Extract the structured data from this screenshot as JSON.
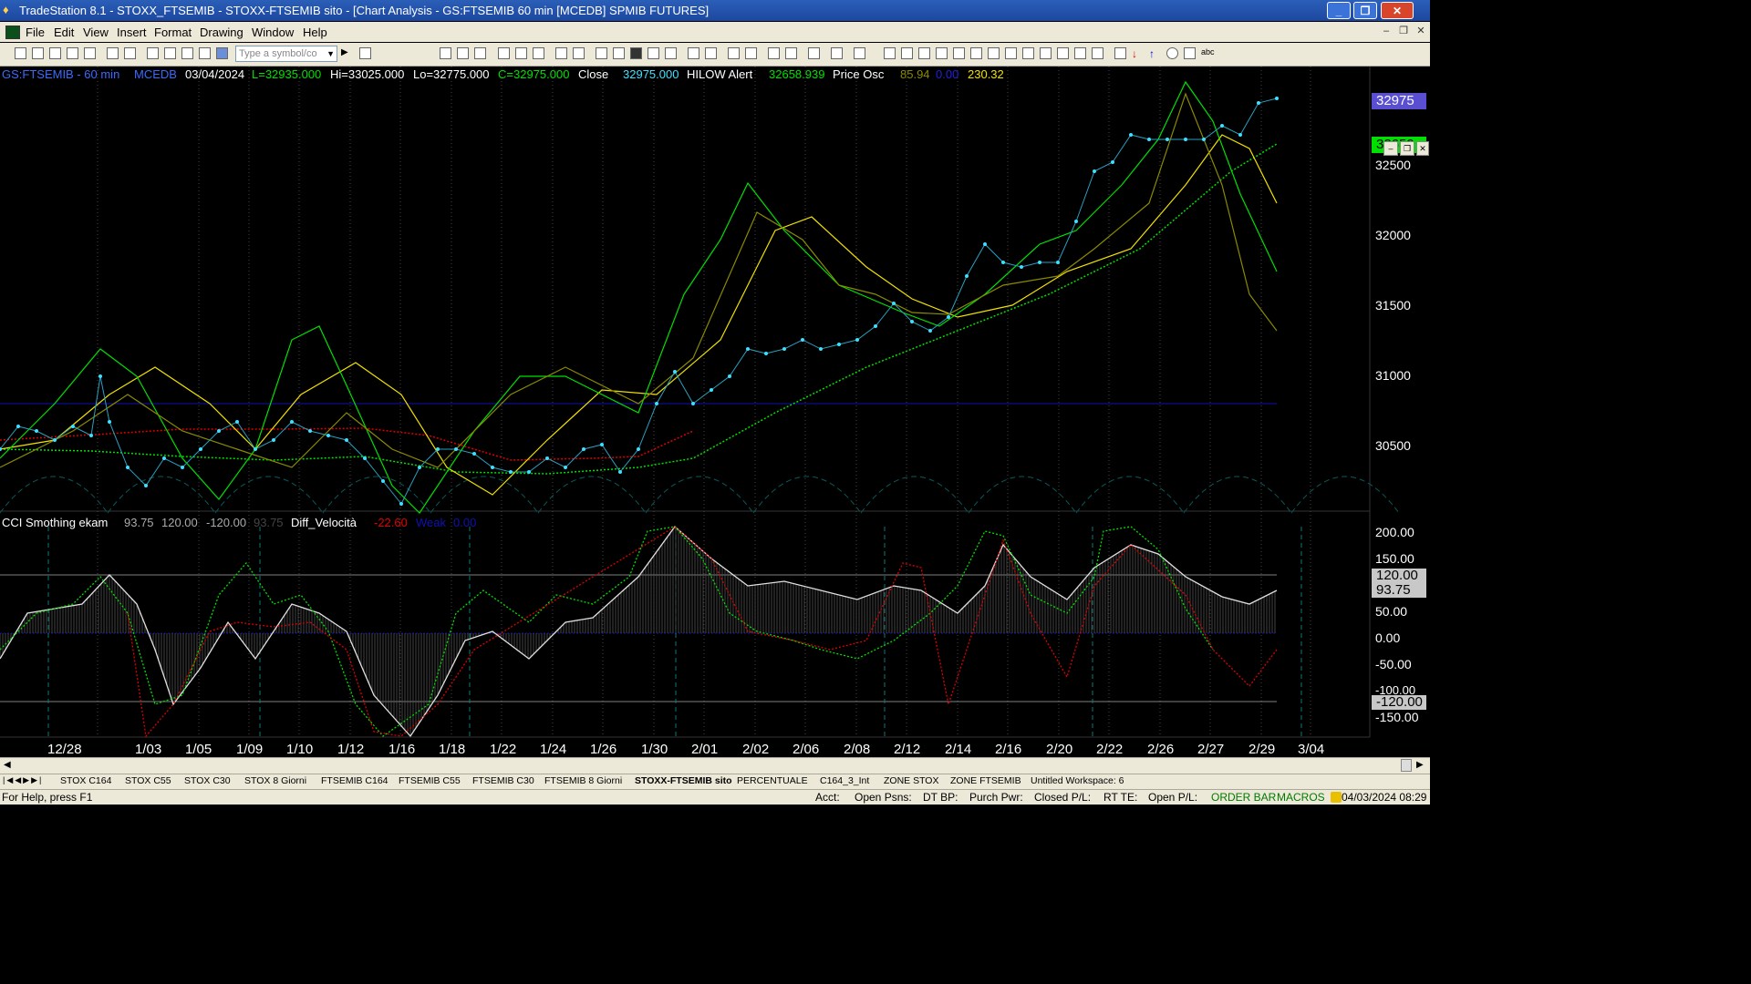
{
  "window": {
    "title": "TradeStation 8.1 - STOXX_FTSEMIB - STOXX-FTSEMIB sito - [Chart Analysis - GS:FTSEMIB  60 min  [MCEDB] SPMIB FUTURES]",
    "min_label": "_",
    "max_label": "❐",
    "close_label": "✕"
  },
  "menu": {
    "items": [
      "File",
      "Edit",
      "View",
      "Insert",
      "Format",
      "Drawing",
      "Window",
      "Help"
    ]
  },
  "toolbar": {
    "symbol_placeholder": "Type a symbol/co"
  },
  "chart_header": {
    "symbol": "GS:FTSEMIB - 60 min",
    "feed": "MCEDB",
    "date": "03/04/2024",
    "last": "L=32935.000",
    "high": "Hi=33025.000",
    "low": "Lo=32775.000",
    "close": "C=32975.000",
    "close_label": "Close",
    "close_value": "32975.000",
    "hilow_label": "HILOW Alert",
    "hilow_value": "32658.939",
    "osc_label": "Price Osc",
    "osc_v1": "85.94",
    "osc_v2": "0.00",
    "osc_v3": "230.32"
  },
  "sub_header": {
    "name": "CCI Smothing ekam",
    "v1": "93.75",
    "v2": "120.00",
    "v3": "-120.00",
    "v4": "93.75",
    "diff_label": "Diff_Velocità",
    "diff_value": "-22.60",
    "weak_label": "Weak",
    "weak_value": "0.00"
  },
  "price_axis": {
    "labels": [
      "32500",
      "32000",
      "31500",
      "31000",
      "30500"
    ],
    "last_box": "32975",
    "alert_box": "32659"
  },
  "osc_axis": {
    "labels": [
      "200.00",
      "150.00",
      "100.00",
      "50.00",
      "0.00",
      "-50.00",
      "-100.00",
      "-150.00"
    ],
    "box_120": "120.00",
    "box_9375": "93.75",
    "box_m120": "-120.00"
  },
  "date_axis": [
    "12/28",
    "1/03",
    "1/05",
    "1/09",
    "1/10",
    "1/12",
    "1/16",
    "1/18",
    "1/22",
    "1/24",
    "1/26",
    "1/30",
    "2/01",
    "2/02",
    "2/06",
    "2/08",
    "2/12",
    "2/14",
    "2/16",
    "2/20",
    "2/22",
    "2/26",
    "2/27",
    "2/29",
    "3/04"
  ],
  "tabs": [
    "STOX C164",
    "STOX C55",
    "STOX  C30",
    "STOX  8 Giorni",
    "FTSEMIB C164",
    "FTSEMIB C55",
    "FTSEMIB C30",
    "FTSEMIB  8 Giorni",
    "STOXX-FTSEMIB sito",
    "PERCENTUALE",
    "C164_3_Int",
    "ZONE STOX",
    "ZONE FTSEMIB",
    "Untitled Workspace:  6"
  ],
  "active_tab": "STOXX-FTSEMIB sito",
  "status": {
    "help": "For Help, press F1",
    "acct": "Acct:",
    "open_psns": "Open Psns:",
    "dt_bp": "DT BP:",
    "purch_pwr": "Purch Pwr:",
    "closed_pl": "Closed P/L:",
    "rt_te": "RT TE:",
    "open_pl": "Open P/L:",
    "order_bar": "ORDER BAR",
    "macros": "MACROS",
    "datetime": "04/03/2024 08:29"
  },
  "colors": {
    "price_dots": "#3fe0ff",
    "ma_green": "#00e000",
    "ma_yellow": "#f0e000",
    "ma_olive": "#8a8a00",
    "red_dots": "#e00000",
    "blue_line": "#1010b0",
    "teal_arcs": "#0a5a5a",
    "osc_line": "#e0e0e0"
  }
}
